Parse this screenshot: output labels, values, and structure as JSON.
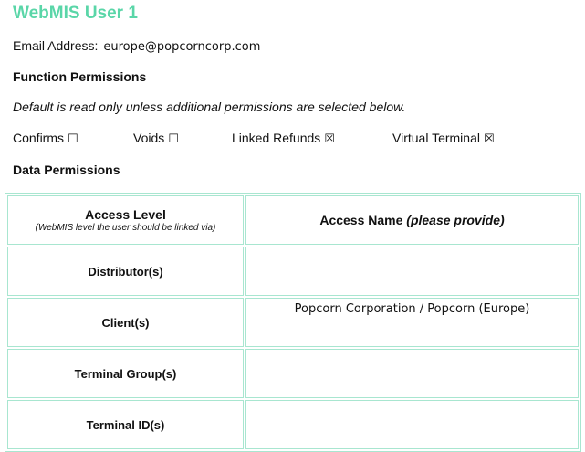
{
  "header": {
    "title": "WebMIS User 1"
  },
  "email": {
    "label": "Email Address:",
    "value": "europe@popcorncorp.com"
  },
  "function_permissions": {
    "heading": "Function Permissions",
    "note": "Default is read only unless additional permissions are selected below.",
    "items": [
      {
        "label": "Confirms",
        "box": "☐",
        "checked": false
      },
      {
        "label": "Voids",
        "box": "☐",
        "checked": false
      },
      {
        "label": "Linked Refunds",
        "box": "☒",
        "checked": true
      },
      {
        "label": "Virtual Terminal",
        "box": "☒",
        "checked": true
      }
    ]
  },
  "data_permissions": {
    "heading": "Data Permissions",
    "table": {
      "col1_header": "Access Level",
      "col1_subheader": "(WebMIS level the user should be linked via)",
      "col2_header_main": "Access Name",
      "col2_header_italic": "(please provide)",
      "rows": [
        {
          "level": "Distributor(s)",
          "name": ""
        },
        {
          "level": "Client(s)",
          "name": "Popcorn Corporation / Popcorn (Europe)"
        },
        {
          "level": "Terminal Group(s)",
          "name": ""
        },
        {
          "level": "Terminal ID(s)",
          "name": ""
        }
      ]
    }
  },
  "colors": {
    "title": "#5ad6a8",
    "table_border": "#a8e6d0"
  }
}
